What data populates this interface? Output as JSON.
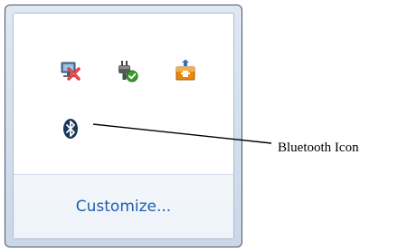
{
  "customize": {
    "label": "Customize..."
  },
  "callout": {
    "label": "Bluetooth Icon"
  },
  "icons": [
    {
      "name": "action-center-icon"
    },
    {
      "name": "safely-remove-hardware-icon"
    },
    {
      "name": "network-share-icon"
    },
    {
      "name": "bluetooth-icon"
    }
  ],
  "colors": {
    "link": "#1e5ead",
    "bluetooth_bg": "#17385c",
    "check_green": "#3a9d2b",
    "cross_red": "#d62b2b",
    "share_orange": "#e8860e"
  }
}
